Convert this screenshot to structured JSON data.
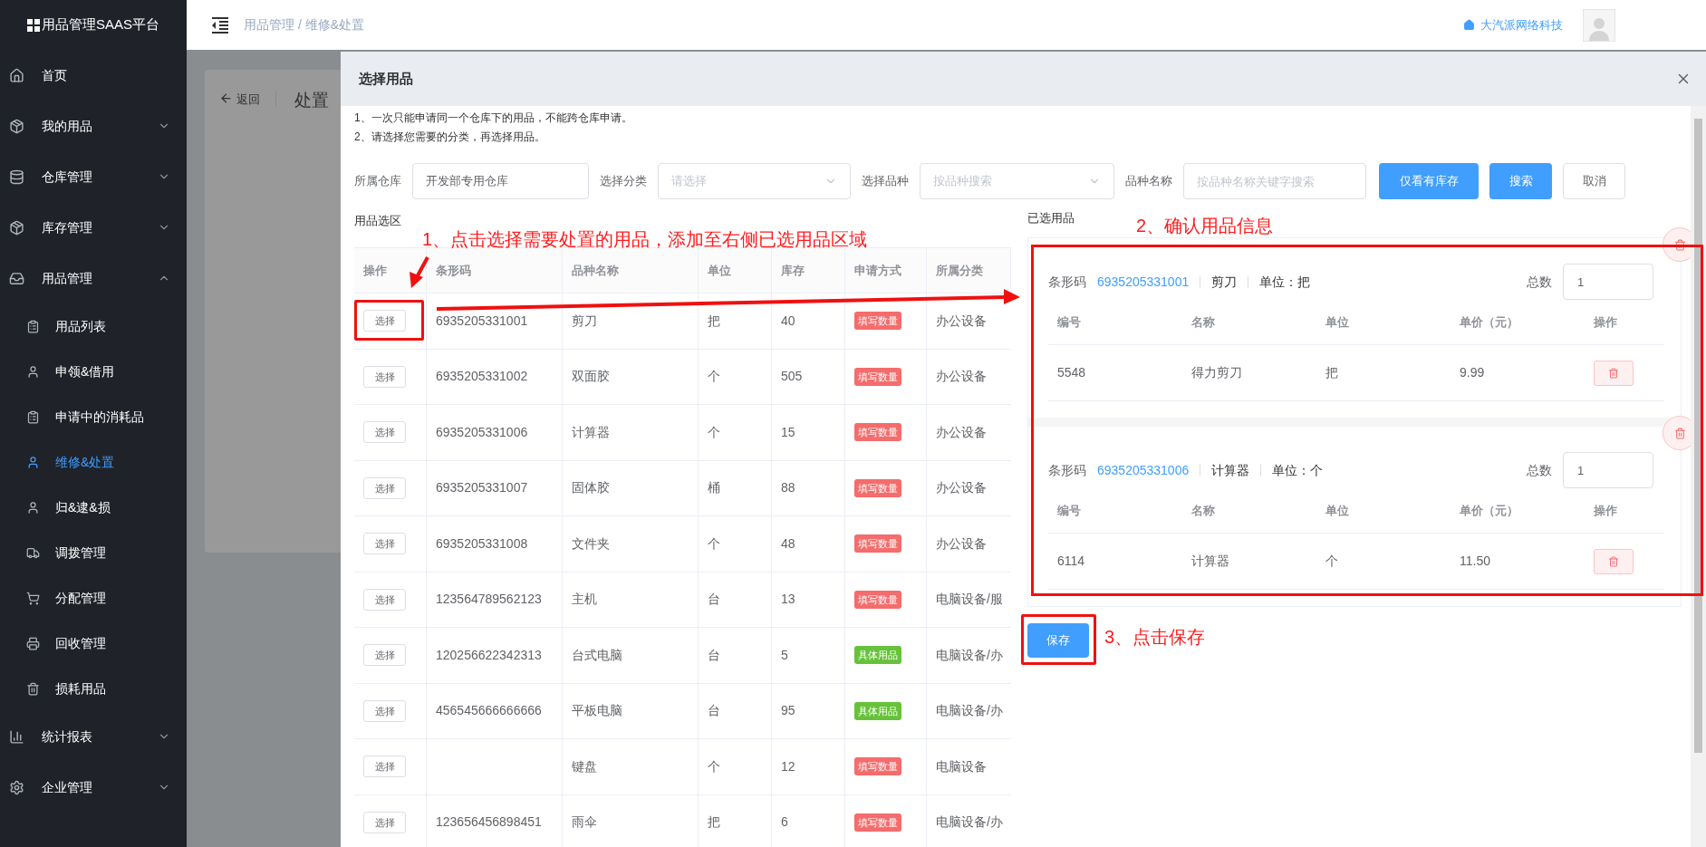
{
  "sidebar": {
    "logo": "用品管理SAAS平台",
    "items": [
      {
        "label": "首页",
        "kind": "link"
      },
      {
        "label": "我的用品",
        "kind": "group",
        "expanded": false
      },
      {
        "label": "仓库管理",
        "kind": "group",
        "expanded": false
      },
      {
        "label": "库存管理",
        "kind": "group",
        "expanded": false
      },
      {
        "label": "用品管理",
        "kind": "group",
        "expanded": true,
        "children": [
          {
            "label": "用品列表",
            "selected": false
          },
          {
            "label": "申领&借用",
            "selected": false
          },
          {
            "label": "申请中的消耗品",
            "selected": false
          },
          {
            "label": "维修&处置",
            "selected": true
          },
          {
            "label": "归&逮&损",
            "selected": false
          },
          {
            "label": "调拨管理",
            "selected": false
          },
          {
            "label": "分配管理",
            "selected": false
          },
          {
            "label": "回收管理",
            "selected": false
          },
          {
            "label": "损耗用品",
            "selected": false
          }
        ]
      },
      {
        "label": "统计报表",
        "kind": "group",
        "expanded": false
      },
      {
        "label": "企业管理",
        "kind": "group",
        "expanded": false
      }
    ]
  },
  "header": {
    "breadcrumb": "用品管理 / 维修&处置",
    "company": "大汽派网络科技"
  },
  "background_page": {
    "back": "返回",
    "title": "处置"
  },
  "dialog": {
    "title": "选择用品",
    "notes": [
      "1、一次只能申请同一个仓库下的用品，不能跨仓库申请。",
      "2、请选择您需要的分类，再选择用品。"
    ],
    "filters": [
      {
        "label": "所属仓库",
        "kind": "input",
        "value": "开发部专用仓库"
      },
      {
        "label": "选择分类",
        "kind": "select",
        "placeholder": "请选择"
      },
      {
        "label": "选择品种",
        "kind": "select",
        "placeholder": "按品种搜索"
      },
      {
        "label": "品种名称",
        "kind": "input",
        "placeholder": "按品种名称关键字搜索"
      }
    ],
    "buttons": [
      {
        "label": "仅看有库存",
        "kind": "primary"
      },
      {
        "label": "搜索",
        "kind": "primary"
      },
      {
        "label": "取消",
        "kind": "default"
      }
    ],
    "picker": {
      "title": "用品选区",
      "columns": [
        "操作",
        "条形码",
        "品种名称",
        "单位",
        "库存",
        "申请方式",
        "所属分类"
      ],
      "rows": [
        {
          "action": "选择",
          "barcode": "6935205331001",
          "name": "剪刀",
          "unit": "把",
          "stock": "40",
          "mode": "填写数量",
          "color": "#f56c6c",
          "category": "办公设备"
        },
        {
          "action": "选择",
          "barcode": "6935205331002",
          "name": "双面胶",
          "unit": "个",
          "stock": "505",
          "mode": "填写数量",
          "color": "#f56c6c",
          "category": "办公设备"
        },
        {
          "action": "选择",
          "barcode": "6935205331006",
          "name": "计算器",
          "unit": "个",
          "stock": "15",
          "mode": "填写数量",
          "color": "#f56c6c",
          "category": "办公设备"
        },
        {
          "action": "选择",
          "barcode": "6935205331007",
          "name": "固体胶",
          "unit": "桶",
          "stock": "88",
          "mode": "填写数量",
          "color": "#f56c6c",
          "category": "办公设备"
        },
        {
          "action": "选择",
          "barcode": "6935205331008",
          "name": "文件夹",
          "unit": "个",
          "stock": "48",
          "mode": "填写数量",
          "color": "#f56c6c",
          "category": "办公设备"
        },
        {
          "action": "选择",
          "barcode": "123564789562123",
          "name": "主机",
          "unit": "台",
          "stock": "13",
          "mode": "填写数量",
          "color": "#f56c6c",
          "category": "电脑设备/服"
        },
        {
          "action": "选择",
          "barcode": "120256622342313",
          "name": "台式电脑",
          "unit": "台",
          "stock": "5",
          "mode": "具体用品",
          "color": "#67c23a",
          "category": "电脑设备/办"
        },
        {
          "action": "选择",
          "barcode": "456545666666666",
          "name": "平板电脑",
          "unit": "台",
          "stock": "95",
          "mode": "具体用品",
          "color": "#67c23a",
          "category": "电脑设备/办"
        },
        {
          "action": "选择",
          "name": "键盘",
          "unit": "个",
          "stock": "12",
          "mode": "填写数量",
          "color": "#f56c6c",
          "category": "电脑设备"
        },
        {
          "action": "选择",
          "barcode": "123656456898451",
          "name": "雨伞",
          "unit": "把",
          "stock": "6",
          "mode": "填写数量",
          "color": "#f56c6c",
          "category": "电脑设备/办"
        }
      ]
    },
    "selected": {
      "title": "已选用品",
      "items": [
        {
          "barcode_label": "条形码",
          "barcode": "6935205331001",
          "name": "剪刀",
          "unit": "单位：把",
          "total_label": "总数",
          "total": "1",
          "columns": [
            "编号",
            "名称",
            "单位",
            "单价（元）",
            "操作"
          ],
          "rows": [
            {
              "id": "5548",
              "name": "得力剪刀",
              "unit": "把",
              "price": "9.99"
            }
          ]
        },
        {
          "barcode_label": "条形码",
          "barcode": "6935205331006",
          "name": "计算器",
          "unit": "单位：个",
          "total_label": "总数",
          "total": "1",
          "columns": [
            "编号",
            "名称",
            "单位",
            "单价（元）",
            "操作"
          ],
          "rows": [
            {
              "id": "6114",
              "name": "计算器",
              "unit": "个",
              "price": "11.50"
            }
          ]
        }
      ]
    },
    "save": "保存"
  },
  "annotations": [
    "1、点击选择需要处置的用品，添加至右侧已选用品区域",
    "2、确认用品信息",
    "3、点击保存"
  ]
}
